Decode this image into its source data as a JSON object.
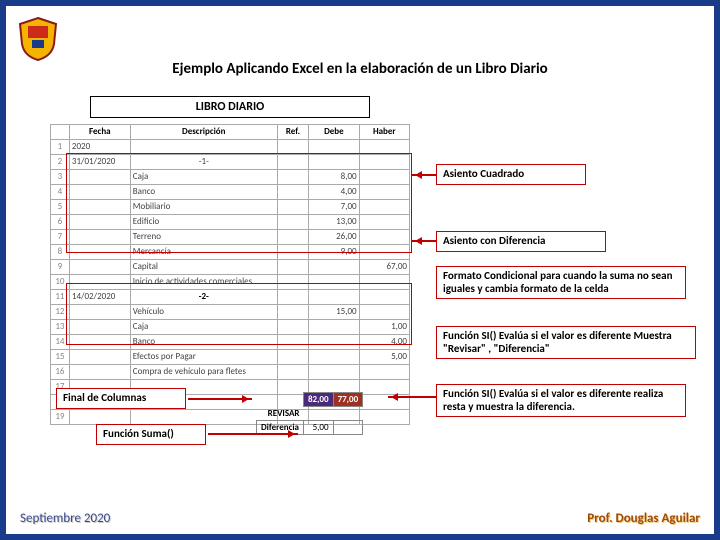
{
  "title": "Ejemplo Aplicando Excel en la elaboración de un Libro Diario",
  "sheet_title": "LIBRO DIARIO",
  "columns": {
    "fecha": "Fecha",
    "desc": "Descripción",
    "ref": "Ref.",
    "debe": "Debe",
    "haber": "Haber"
  },
  "rows": [
    {
      "n": "1",
      "fecha": "2020",
      "desc": "",
      "ref": "",
      "debe": "",
      "haber": ""
    },
    {
      "n": "2",
      "fecha": "31/01/2020",
      "desc": "-1-",
      "ref": "",
      "debe": "",
      "haber": "",
      "center_desc": true
    },
    {
      "n": "3",
      "fecha": "",
      "desc": "Caja",
      "ref": "",
      "debe": "8,00",
      "haber": ""
    },
    {
      "n": "4",
      "fecha": "",
      "desc": "Banco",
      "ref": "",
      "debe": "4,00",
      "haber": ""
    },
    {
      "n": "5",
      "fecha": "",
      "desc": "Mobiliario",
      "ref": "",
      "debe": "7,00",
      "haber": ""
    },
    {
      "n": "6",
      "fecha": "",
      "desc": "Edificio",
      "ref": "",
      "debe": "13,00",
      "haber": ""
    },
    {
      "n": "7",
      "fecha": "",
      "desc": "Terreno",
      "ref": "",
      "debe": "26,00",
      "haber": ""
    },
    {
      "n": "8",
      "fecha": "",
      "desc": "Mercancía",
      "ref": "",
      "debe": "9,00",
      "haber": ""
    },
    {
      "n": "9",
      "fecha": "",
      "desc": "Capital",
      "ref": "",
      "debe": "",
      "haber": "67,00"
    },
    {
      "n": "10",
      "fecha": "",
      "desc": "Inicio de actividades comerciales",
      "ref": "",
      "debe": "",
      "haber": ""
    },
    {
      "n": "11",
      "fecha": "14/02/2020",
      "desc": "-2-",
      "ref": "",
      "debe": "",
      "haber": "",
      "center_desc": true,
      "bold": true
    },
    {
      "n": "12",
      "fecha": "",
      "desc": "Vehículo",
      "ref": "",
      "debe": "15,00",
      "haber": ""
    },
    {
      "n": "13",
      "fecha": "",
      "desc": "Caja",
      "ref": "",
      "debe": "",
      "haber": "1,00"
    },
    {
      "n": "14",
      "fecha": "",
      "desc": "Banco",
      "ref": "",
      "debe": "",
      "haber": "4,00"
    },
    {
      "n": "15",
      "fecha": "",
      "desc": "Efectos por Pagar",
      "ref": "",
      "debe": "",
      "haber": "5,00"
    },
    {
      "n": "16",
      "fecha": "",
      "desc": "Compra de vehículo para fletes",
      "ref": "",
      "debe": "",
      "haber": ""
    },
    {
      "n": "17",
      "fecha": "",
      "desc": "",
      "ref": "",
      "debe": "",
      "haber": ""
    },
    {
      "n": "18",
      "fecha": "",
      "desc": "",
      "ref": "",
      "debe": "",
      "haber": ""
    },
    {
      "n": "19",
      "fecha": "",
      "desc": "",
      "ref": "",
      "debe": "",
      "haber": ""
    }
  ],
  "summary": {
    "total_debe": "82,00",
    "total_haber": "77,00",
    "revisar_label": "REVISAR",
    "dif_label": "Diferencia",
    "dif_value": "5,00"
  },
  "notes": {
    "asiento_cuadrado": "Asiento Cuadrado",
    "asiento_dif": "Asiento con Diferencia",
    "formato_cond": "Formato Condicional para cuando  la suma no sean iguales y cambia formato de la celda",
    "funcion_si_1": "Función SI() Evalúa si el valor es diferente Muestra \"Revisar\" , \"Diferencia\"",
    "funcion_si_2": "Función SI() Evalúa si el valor es diferente  realiza resta y muestra  la diferencia.",
    "final_cols": "Final de Columnas",
    "funcion_suma": "Función Suma()"
  },
  "footer": {
    "left": "Septiembre 2020",
    "right": "Prof. Douglas Aguilar"
  }
}
